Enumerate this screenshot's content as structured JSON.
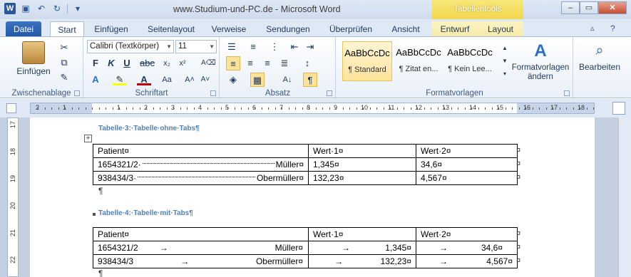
{
  "window": {
    "title": "www.Studium-und-PC.de  -  Microsoft Word",
    "context_tab_header": "Tabellentools",
    "logo_letter": "W"
  },
  "tabs": {
    "file": "Datei",
    "items": [
      "Start",
      "Einfügen",
      "Seitenlayout",
      "Verweise",
      "Sendungen",
      "Überprüfen",
      "Ansicht",
      "Entwurf",
      "Layout"
    ]
  },
  "ribbon": {
    "clipboard": {
      "paste": "Einfügen",
      "label": "Zwischenablage"
    },
    "font": {
      "font_name": "Calibri (Textkörper)",
      "font_size": "11",
      "label": "Schriftart"
    },
    "paragraph": {
      "label": "Absatz"
    },
    "styles": {
      "label": "Formatvorlagen",
      "tiles": [
        {
          "sample": "AaBbCcDc",
          "name": "¶ Standard"
        },
        {
          "sample": "AaBbCcDc",
          "name": "¶ Zitat en..."
        },
        {
          "sample": "AaBbCcDc",
          "name": "¶ Kein Lee..."
        }
      ],
      "change_line1": "Formatvorlagen",
      "change_line2": "ändern"
    },
    "editing": {
      "label": "Bearbeiten"
    }
  },
  "ruler": {
    "numbers": [
      "2",
      "1",
      "1",
      "2",
      "3",
      "4",
      "5",
      "6",
      "7",
      "8",
      "9",
      "10",
      "11",
      "12",
      "13",
      "14",
      "15",
      "16",
      "17",
      "18"
    ],
    "vnumbers": [
      "17",
      "18",
      "19",
      "20",
      "21",
      "22"
    ]
  },
  "document": {
    "heading1": "Tabelle·3:·Tabelle·ohne·Tabs¶",
    "heading2": "Tabelle·4:·Tabelle·mit·Tabs¶",
    "table1": {
      "header": [
        "Patient¤",
        "Wert·1¤",
        "Wert·2¤"
      ],
      "rows": [
        {
          "left": "1654321/2·",
          "right": "Müller¤",
          "v1": "1,345¤",
          "v2": "34,6¤"
        },
        {
          "left": "938434/3·",
          "right": "Obermüller¤",
          "v1": "132,23¤",
          "v2": "4,567¤"
        }
      ]
    },
    "table2": {
      "header": [
        "Patient¤",
        "Wert·1¤",
        "Wert·2¤"
      ],
      "rows": [
        {
          "left": "1654321/2",
          "right": "Müller¤",
          "v1": "1,345¤",
          "v2": "34,6¤"
        },
        {
          "left": "938434/3",
          "right": "Obermüller¤",
          "v1": "132,23¤",
          "v2": "4,567¤"
        }
      ]
    },
    "pilcrow": "¶",
    "end_of_row": "¤",
    "tab_arrow": "→",
    "move_handle": "+"
  }
}
